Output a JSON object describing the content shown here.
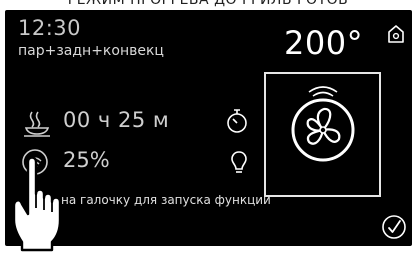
{
  "page": {
    "top_caption": "РЕЖИМ ПРОГРЕВА ДО ГРИЛЬ ГОТОВ"
  },
  "header": {
    "time": "12:30",
    "program": "пар+задн+конвекц",
    "temperature": "200°"
  },
  "settings": {
    "duration": "00 ч 25 м",
    "humidity": "25%"
  },
  "hint": {
    "text": "на   галочку для запуска функции"
  },
  "icons": {
    "home": "home-icon",
    "fan": "fan-icon",
    "cook": "dish-icon",
    "timer": "timer-icon",
    "steam": "steam-icon",
    "bulb": "lightbulb-icon",
    "check": "check-icon",
    "hand": "pointing-hand-icon"
  },
  "colors": {
    "screen_background": "#000000",
    "text_primary": "#ffffff",
    "text_secondary": "#cfcfcf"
  }
}
